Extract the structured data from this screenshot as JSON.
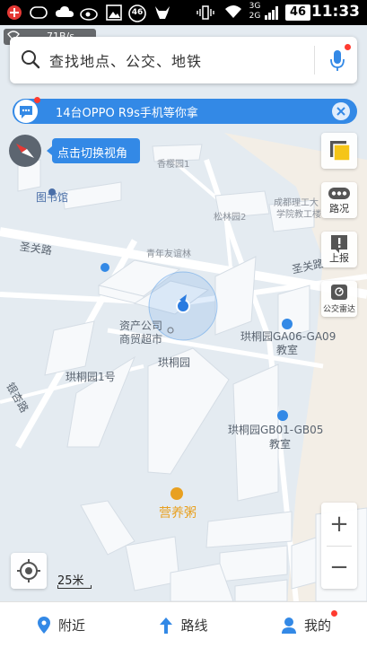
{
  "status_bar": {
    "network_badge": "46",
    "signal_3g": "3G",
    "signal_2g": "2G",
    "battery_level": "46",
    "time": "11:33"
  },
  "speed_indicator": "71B/s",
  "search": {
    "placeholder": "查找地点、公交、地铁"
  },
  "promo_banner": {
    "text": "14台OPPO R9s手机等你拿"
  },
  "view_switch_tip": "点击切换视角",
  "right_tools": {
    "traffic_label": "路况",
    "report_label": "上报",
    "bus_radar_label": "公交雷达"
  },
  "map_labels": {
    "library": "图书馆",
    "xiangyuan": "香樱园1",
    "chengdu_institute": "成都理工大",
    "institute_sub": "学院教工楼",
    "songlin": "松林园2",
    "shengguan_road_left": "圣关路",
    "shengguan_road_right": "圣关路",
    "youth_forest": "青年友谊林",
    "asset_company": "资产公司",
    "mall": "商贸超市",
    "gongtongyuan": "珙桐园",
    "gongtongyuan1": "珙桐园1号",
    "gongtongyuan_ga": "珙桐园GA06-GA09",
    "classroom1": "教室",
    "gongtongyuan_gb": "珙桐园GB01-GB05",
    "classroom2": "教室",
    "yinxing_road": "银杏路",
    "porridge": "营养粥"
  },
  "zoom": {
    "in": "+",
    "out": "−"
  },
  "scale": "25米",
  "bottom_nav": {
    "nearby": "附近",
    "route": "路线",
    "mine": "我的"
  },
  "colors": {
    "accent_blue": "#3389e6",
    "alert_red": "#ff3b30",
    "porridge_orange": "#e8a020"
  }
}
